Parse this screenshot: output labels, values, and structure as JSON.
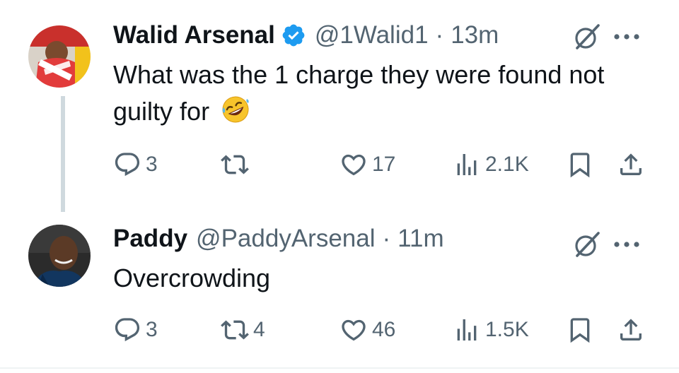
{
  "tweets": [
    {
      "name": "Walid Arsenal",
      "verified": true,
      "handle": "@1Walid1",
      "separator": "·",
      "time": "13m",
      "text": "What was the 1 charge they were found not guilty for",
      "emoji": "rolling-on-floor-laughing-emoji",
      "stats": {
        "replies": "3",
        "reposts": "",
        "likes": "17",
        "views": "2.1K"
      }
    },
    {
      "name": "Paddy",
      "verified": false,
      "handle": "@PaddyArsenal",
      "separator": "·",
      "time": "11m",
      "text": "Overcrowding",
      "stats": {
        "replies": "3",
        "reposts": "4",
        "likes": "46",
        "views": "1.5K"
      }
    }
  ],
  "colors": {
    "text": "#0f1419",
    "muted": "#536471",
    "verified": "#1d9bf0",
    "thread_line": "#cfd9de"
  },
  "icons": [
    "grok-icon",
    "more-icon",
    "reply-icon",
    "repost-icon",
    "like-icon",
    "views-icon",
    "bookmark-icon",
    "share-icon",
    "verified-badge-icon"
  ]
}
